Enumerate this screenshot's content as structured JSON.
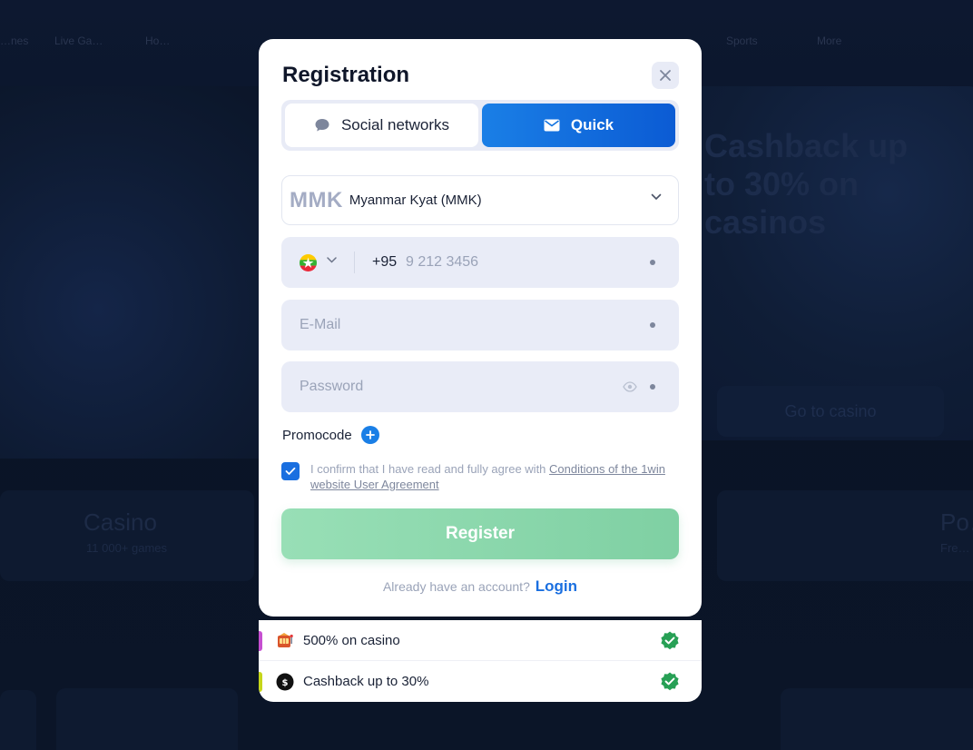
{
  "background": {
    "nav": [
      "…nes",
      "Live Ga…",
      "Ho…",
      "Sports",
      "More"
    ],
    "banner_text": "Cashback up to 30% on casinos",
    "banner_button": "Go to casino",
    "casino_card": {
      "title": "Casino",
      "subtitle": "11 000+ games"
    },
    "poker_card": {
      "title": "Po…",
      "subtitle": "Fre…"
    }
  },
  "modal": {
    "title": "Registration",
    "close_icon": "close-icon",
    "tabs": [
      {
        "label": "Social networks",
        "icon": "chat-bubble-icon",
        "active": false
      },
      {
        "label": "Quick",
        "icon": "envelope-icon",
        "active": true
      }
    ],
    "currency": {
      "code": "MMK",
      "name": "Myanmar Kyat (MMK)"
    },
    "phone": {
      "country_code": "+95",
      "placeholder": "9 212 3456",
      "flag": "myanmar-flag-icon"
    },
    "email": {
      "placeholder": "E-Mail"
    },
    "password": {
      "placeholder": "Password"
    },
    "promocode_label": "Promocode",
    "agreement": {
      "text": "I confirm that I have read and fully agree with ",
      "link": "Conditions of the 1win website User Agreement",
      "checked": true
    },
    "register_label": "Register",
    "login_prompt": "Already have an account?",
    "login_link": "Login"
  },
  "bonuses": [
    {
      "text": "500% on casino",
      "icon": "slot-machine-icon",
      "accent": "#c64fd1"
    },
    {
      "text": "Cashback up to 30%",
      "icon": "cashback-icon",
      "accent": "#c6d61a"
    }
  ],
  "colors": {
    "accent_blue": "#1a7fe6",
    "register_green": "#8fd9b0",
    "check_green": "#27a055"
  }
}
